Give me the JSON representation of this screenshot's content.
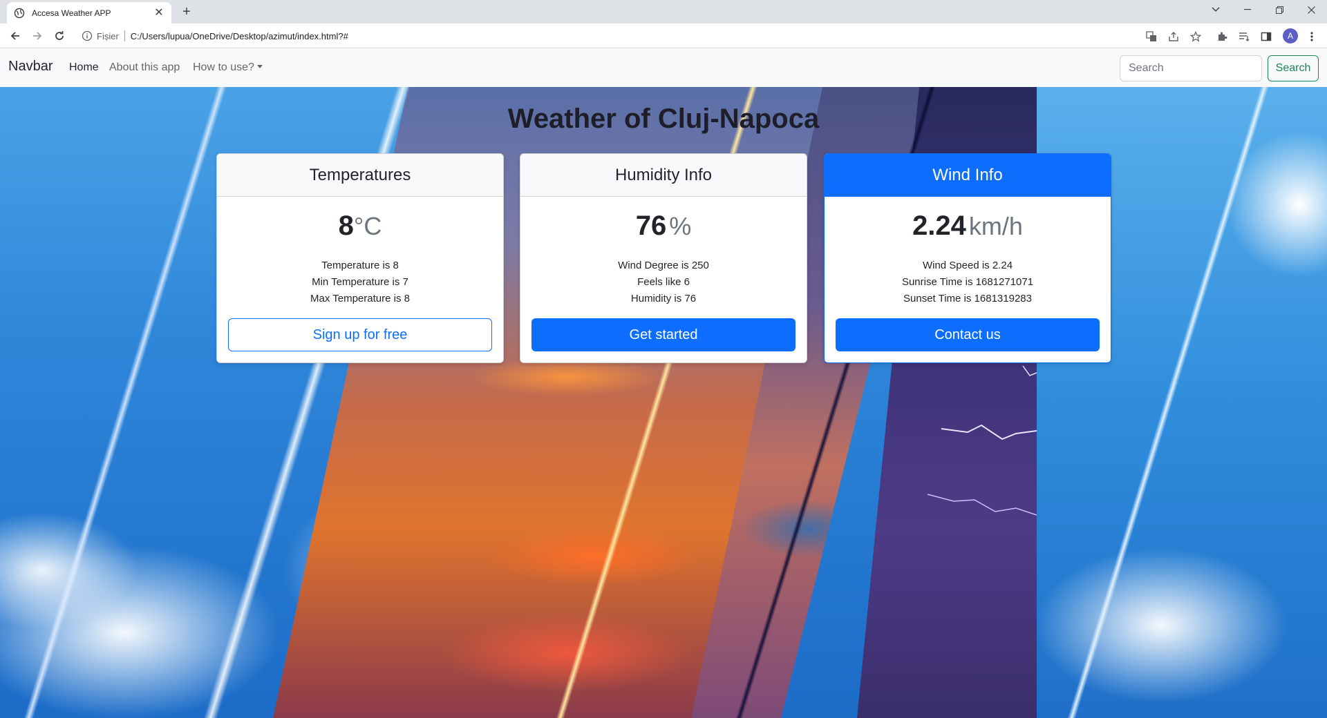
{
  "browser": {
    "tab_title": "Accesa Weather APP",
    "tab_close": "✕",
    "new_tab": "+",
    "url_scheme_label": "Fișier",
    "url": "C:/Users/lupua/OneDrive/Desktop/azimut/index.html?#",
    "profile_initial": "A"
  },
  "navbar": {
    "brand": "Navbar",
    "links": [
      "Home",
      "About this app",
      "How to use?"
    ],
    "search_placeholder": "Search",
    "search_button": "Search"
  },
  "page": {
    "title": "Weather of Cluj-Napoca"
  },
  "cards": [
    {
      "header": "Temperatures",
      "value": "8",
      "unit": "°C",
      "lines": [
        "Temperature is 8",
        "Min Temperature is 7",
        "Max Temperature is 8"
      ],
      "button": "Sign up for free"
    },
    {
      "header": "Humidity Info",
      "value": "76",
      "unit": "%",
      "lines": [
        "Wind Degree is 250",
        "Feels like 6",
        "Humidity is 76"
      ],
      "button": "Get started"
    },
    {
      "header": "Wind Info",
      "value": "2.24",
      "unit": "km/h",
      "lines": [
        "Wind Speed is 2.24",
        "Sunrise Time is 1681271071",
        "Sunset Time is 1681319283"
      ],
      "button": "Contact us"
    }
  ],
  "colors": {
    "primary": "#0d6efd",
    "success": "#198754",
    "navbar_bg": "#f8f9fa"
  }
}
